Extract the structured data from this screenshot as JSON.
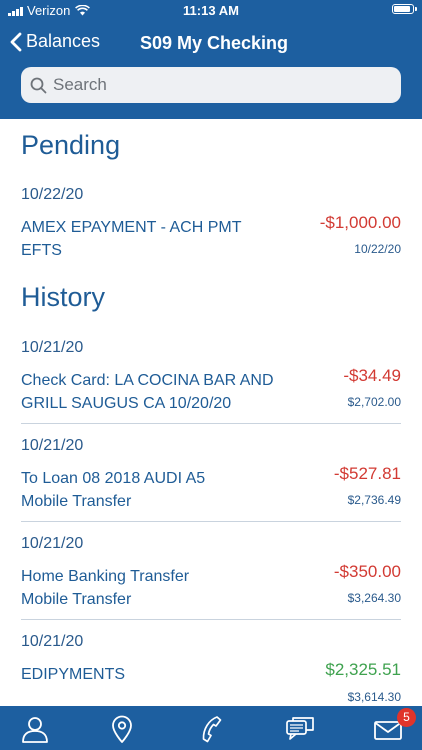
{
  "status_bar": {
    "carrier": "Verizon",
    "time": "11:13 AM",
    "battery_level": 0.9
  },
  "nav": {
    "back_label": "Balances",
    "title": "S09 My Checking"
  },
  "search": {
    "placeholder": "Search"
  },
  "pending": {
    "title": "Pending",
    "transactions": [
      {
        "date": "10/22/20",
        "desc_line1": "AMEX EPAYMENT - ACH PMT",
        "desc_line2": "EFTS",
        "amount": "-$1,000.00",
        "sub": "10/22/20"
      }
    ]
  },
  "history": {
    "title": "History",
    "transactions": [
      {
        "date": "10/21/20",
        "desc_line1": "Check Card: LA COCINA BAR AND",
        "desc_line2": "GRILL SAUGUS CA  10/20/20",
        "amount": "-$34.49",
        "sub": "$2,702.00"
      },
      {
        "date": "10/21/20",
        "desc_line1": "To Loan 08 2018 AUDI A5",
        "desc_line2": "Mobile Transfer",
        "amount": "-$527.81",
        "sub": "$2,736.49"
      },
      {
        "date": "10/21/20",
        "desc_line1": "Home Banking Transfer",
        "desc_line2": "Mobile Transfer",
        "amount": "-$350.00",
        "sub": "$3,264.30"
      },
      {
        "date": "10/21/20",
        "desc_line1": "EDIPYMENTS",
        "desc_line2": "",
        "amount": "$2,325.51",
        "sub": "$3,614.30"
      }
    ]
  },
  "tabbar": {
    "tabs": [
      {
        "icon": "person-icon"
      },
      {
        "icon": "location-pin-icon"
      },
      {
        "icon": "phone-icon"
      },
      {
        "icon": "chat-bubbles-icon"
      },
      {
        "icon": "mail-icon"
      }
    ],
    "mail_badge": "5"
  },
  "colors": {
    "brand_blue": "#1d5fa0",
    "negative": "#d23a33",
    "positive": "#3fa24f",
    "text_blue": "#1f5c96"
  }
}
